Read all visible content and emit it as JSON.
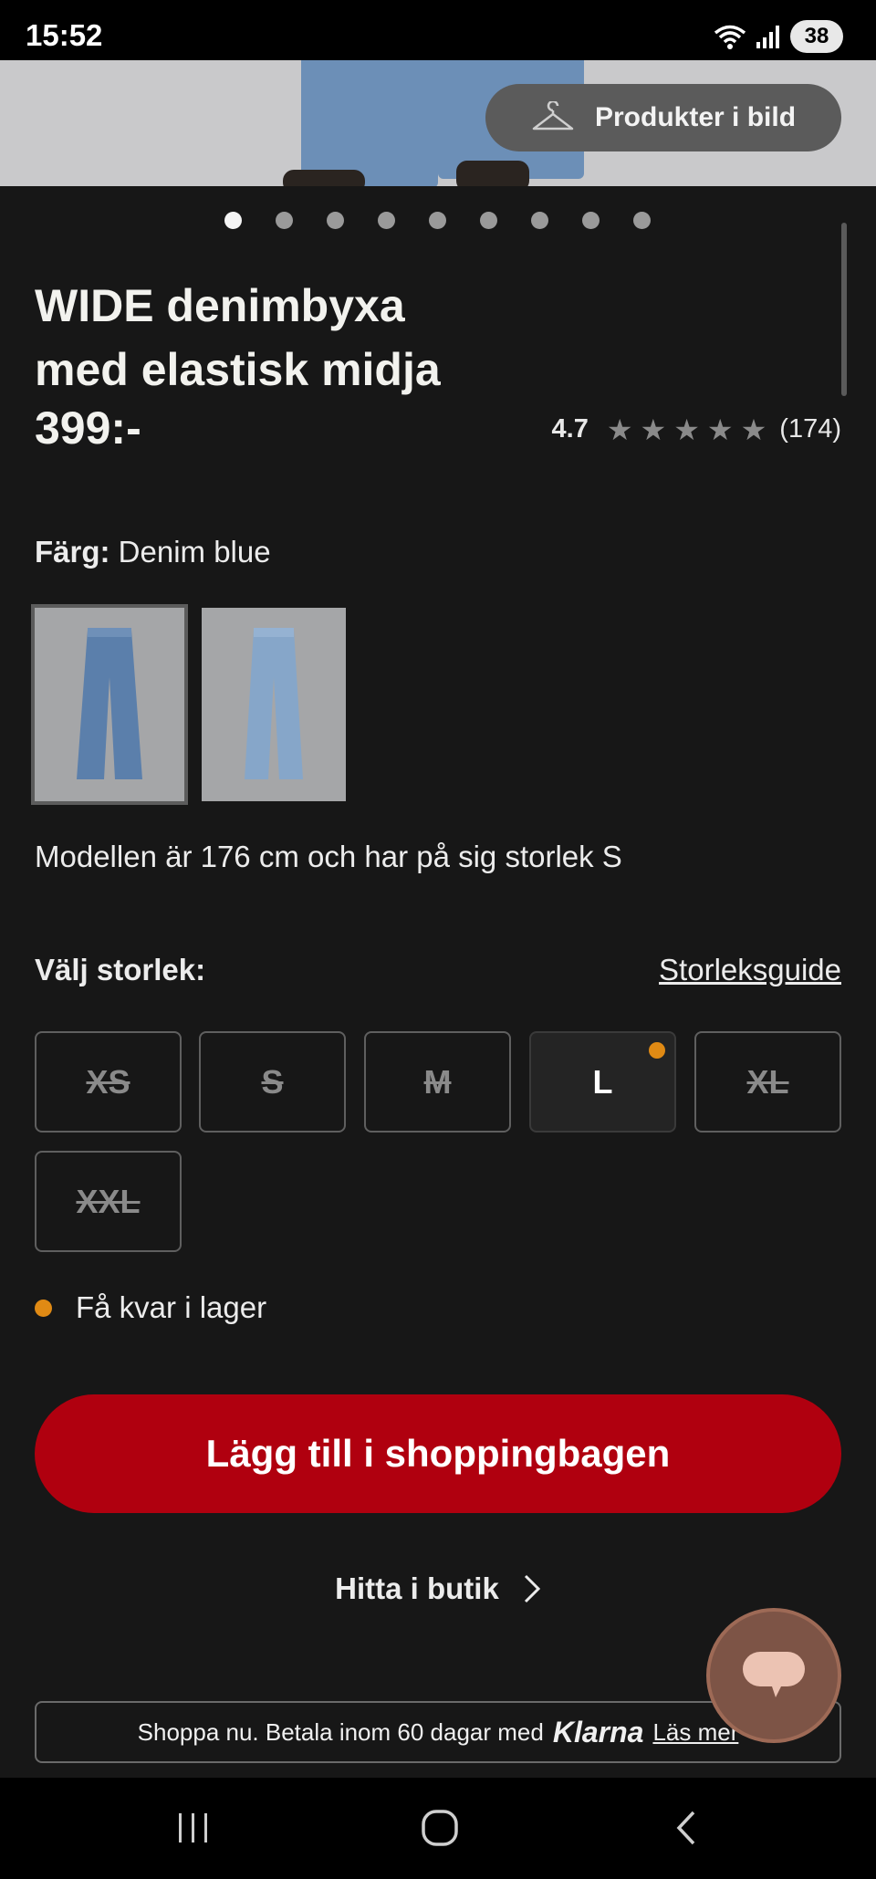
{
  "status_bar": {
    "time": "15:52",
    "battery": "38"
  },
  "hero": {
    "products_in_image_label": "Produkter i bild",
    "image_count": 9,
    "active_index": 0
  },
  "product": {
    "title_line1": "WIDE denimbyxa",
    "title_line2": "med elastisk midja",
    "price": "399:-",
    "rating": "4.7",
    "rating_stars": 5,
    "review_count": "(174)"
  },
  "color": {
    "label": "Färg:",
    "value": "Denim blue"
  },
  "model_info": "Modellen är 176 cm och har på sig storlek S",
  "size_selector": {
    "heading": "Välj storlek:",
    "guide_label": "Storleksguide",
    "sizes": [
      {
        "label": "XS",
        "available": false
      },
      {
        "label": "S",
        "available": false
      },
      {
        "label": "M",
        "available": false
      },
      {
        "label": "L",
        "available": true,
        "low_stock": true
      },
      {
        "label": "XL",
        "available": false
      },
      {
        "label": "XXL",
        "available": false
      }
    ]
  },
  "stock_text": "Få kvar i lager",
  "add_to_bag_label": "Lägg till i shoppingbagen",
  "find_in_store_label": "Hitta i butik",
  "klarna": {
    "text": "Shoppa nu. Betala inom 60 dagar med",
    "logo": "Klarna",
    "more": "Läs mer"
  },
  "colors": {
    "accent_red": "#b0000f",
    "low_stock_orange": "#e08a14",
    "background": "#171717"
  }
}
